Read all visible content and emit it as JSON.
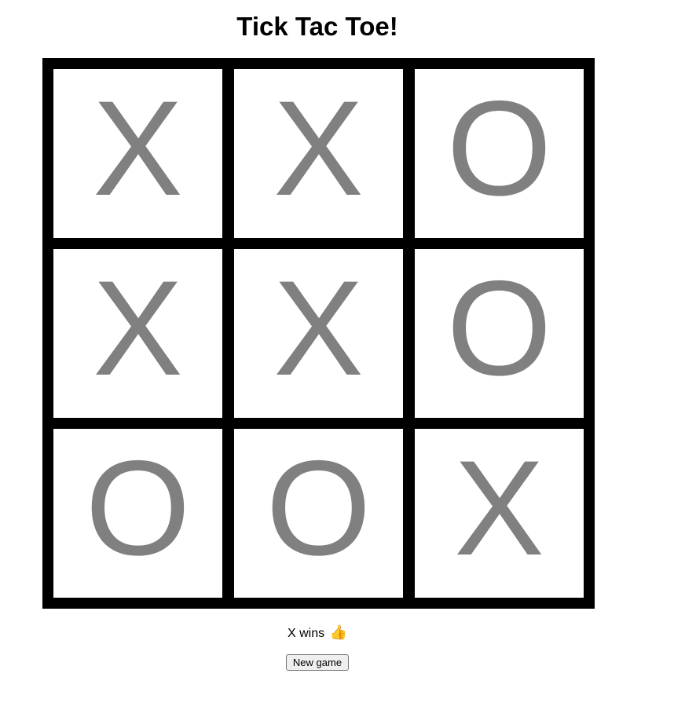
{
  "page_title": "Tick Tac Toe!",
  "board": {
    "cells": [
      "X",
      "X",
      "O",
      "X",
      "X",
      "O",
      "O",
      "O",
      "X"
    ]
  },
  "status": {
    "text": "X wins",
    "emoji": "👍"
  },
  "controls": {
    "new_game_label": "New game"
  },
  "colors": {
    "grid": "#000000",
    "cell_background": "#ffffff",
    "mark": "#808080"
  }
}
